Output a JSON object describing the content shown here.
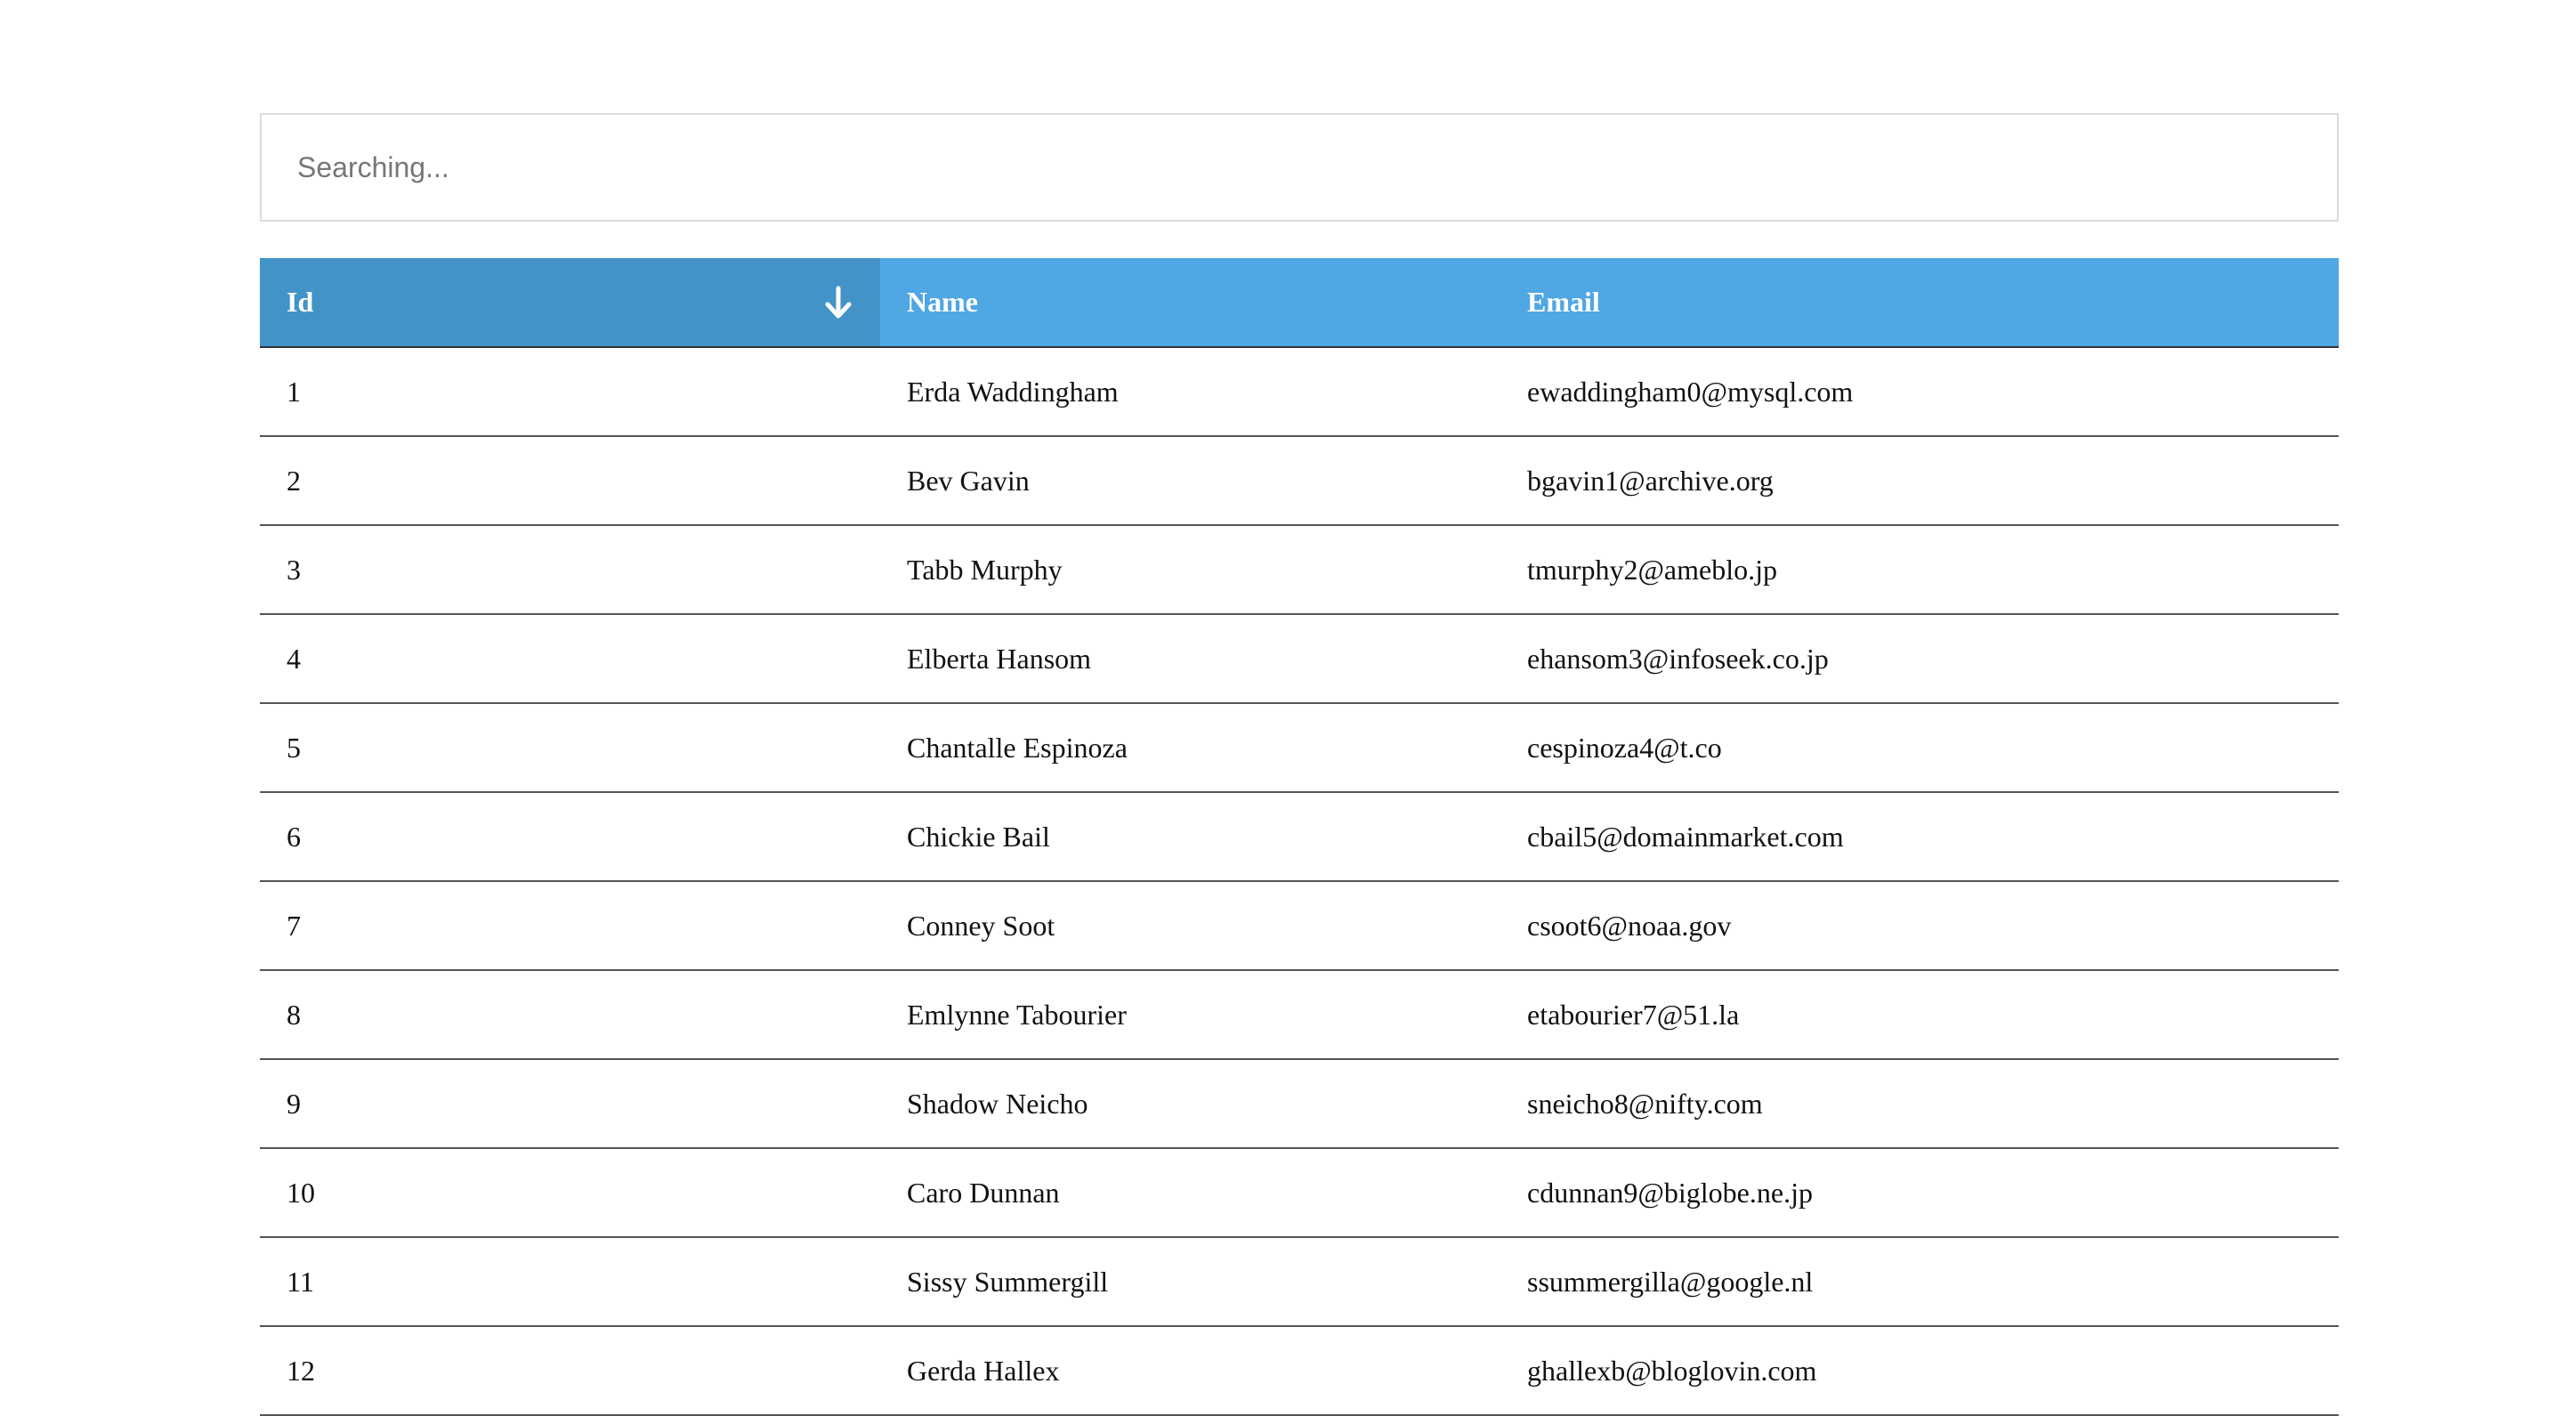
{
  "search": {
    "placeholder": "Searching..."
  },
  "table": {
    "headers": {
      "id": "Id",
      "name": "Name",
      "email": "Email"
    },
    "sort": {
      "column": "id",
      "direction": "descending-arrow",
      "icon": "arrow-down-icon"
    },
    "rows": [
      {
        "id": "1",
        "name": "Erda Waddingham",
        "email": "ewaddingham0@mysql.com"
      },
      {
        "id": "2",
        "name": "Bev Gavin",
        "email": "bgavin1@archive.org"
      },
      {
        "id": "3",
        "name": "Tabb Murphy",
        "email": "tmurphy2@ameblo.jp"
      },
      {
        "id": "4",
        "name": "Elberta Hansom",
        "email": "ehansom3@infoseek.co.jp"
      },
      {
        "id": "5",
        "name": "Chantalle Espinoza",
        "email": "cespinoza4@t.co"
      },
      {
        "id": "6",
        "name": "Chickie Bail",
        "email": "cbail5@domainmarket.com"
      },
      {
        "id": "7",
        "name": "Conney Soot",
        "email": "csoot6@noaa.gov"
      },
      {
        "id": "8",
        "name": "Emlynne Tabourier",
        "email": "etabourier7@51.la"
      },
      {
        "id": "9",
        "name": "Shadow Neicho",
        "email": "sneicho8@nifty.com"
      },
      {
        "id": "10",
        "name": "Caro Dunnan",
        "email": "cdunnan9@biglobe.ne.jp"
      },
      {
        "id": "11",
        "name": "Sissy Summergill",
        "email": "ssummergilla@google.nl"
      },
      {
        "id": "12",
        "name": "Gerda Hallex",
        "email": "ghallexb@bloglovin.com"
      }
    ]
  },
  "colors": {
    "header_bg": "#4fa7e3",
    "header_sorted_bg": "#4393c9",
    "header_text": "#ffffff",
    "row_border": "#555555"
  }
}
